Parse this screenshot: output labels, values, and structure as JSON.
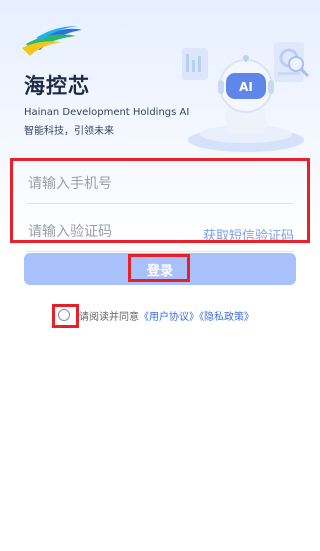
{
  "brand": {
    "title": "海控芯",
    "english_name": "Hainan Development Holdings AI",
    "slogan": "智能科技，引领未来",
    "colors": {
      "logo_yellow": "#f5c518",
      "logo_blue": "#2f6de1",
      "logo_green": "#2bb673"
    }
  },
  "hero": {
    "badge_text": "AI",
    "icon": "ai-robot-illustration"
  },
  "form": {
    "phone_placeholder": "请输入手机号",
    "code_placeholder": "请输入验证码",
    "get_code_label": "获取短信验证码"
  },
  "login": {
    "label": "登录",
    "color": "#a9c1fa"
  },
  "agreement": {
    "prefix": "请阅读并同意",
    "user_agreement": "《用户协议》",
    "privacy_policy": "《隐私政策》",
    "checked": false
  },
  "highlight_color": "#e8202a"
}
